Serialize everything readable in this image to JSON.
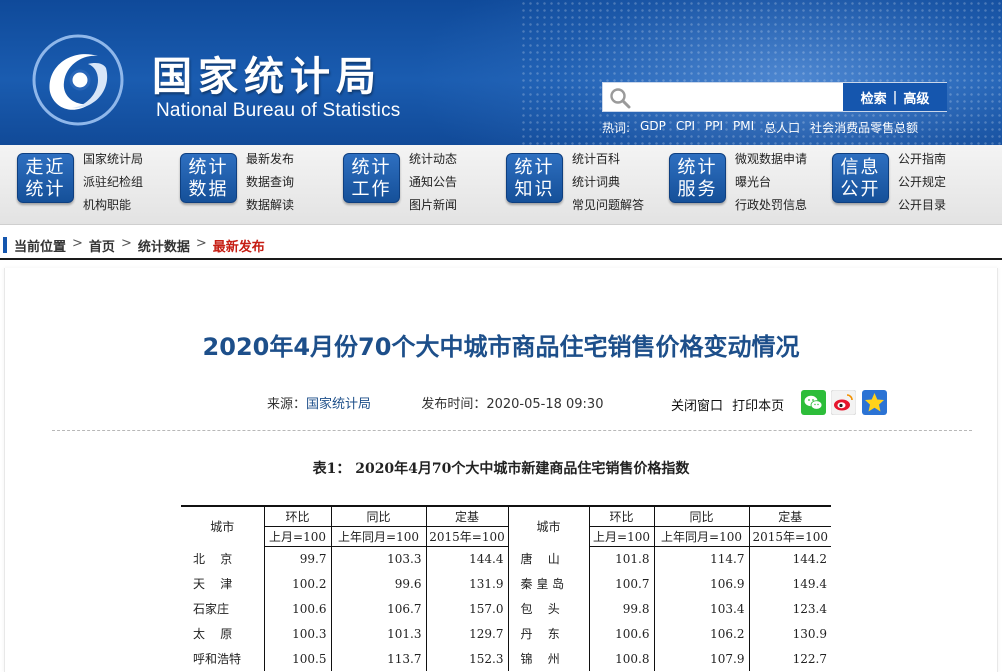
{
  "header": {
    "logo_cn": "国家统计局",
    "logo_en": "National Bureau of Statistics",
    "search": {
      "placeholder": "",
      "btn_search": "检索",
      "btn_sep": "|",
      "btn_advanced": "高级"
    },
    "hot_label": "热词:",
    "hot_words": [
      "GDP",
      "CPI",
      "PPI",
      "PMI",
      "总人口",
      "社会消费品零售总额"
    ]
  },
  "nav": {
    "groups": [
      {
        "tile": [
          "走近",
          "统计"
        ],
        "links": [
          "国家统计局",
          "派驻纪检组",
          "机构职能"
        ]
      },
      {
        "tile": [
          "统计",
          "数据"
        ],
        "links": [
          "最新发布",
          "数据查询",
          "数据解读"
        ]
      },
      {
        "tile": [
          "统计",
          "工作"
        ],
        "links": [
          "统计动态",
          "通知公告",
          "图片新闻"
        ]
      },
      {
        "tile": [
          "统计",
          "知识"
        ],
        "links": [
          "统计百科",
          "统计词典",
          "常见问题解答"
        ]
      },
      {
        "tile": [
          "统计",
          "服务"
        ],
        "links": [
          "微观数据申请",
          "曝光台",
          "行政处罚信息"
        ]
      },
      {
        "tile": [
          "信息",
          "公开"
        ],
        "links": [
          "公开指南",
          "公开规定",
          "公开目录"
        ]
      }
    ]
  },
  "breadcrumb": {
    "items": [
      "当前位置",
      "首页",
      "统计数据"
    ],
    "current": "最新发布",
    "arrow": ">"
  },
  "article": {
    "title": "2020年4月份70个大中城市商品住宅销售价格变动情况",
    "source_label": "来源：",
    "source": "国家统计局",
    "time_label": "发布时间：",
    "time": "2020-05-18 09:30",
    "close_window": "关闭窗口",
    "print_page": "打印本页"
  },
  "table": {
    "caption": "表1：  2020年4月70个大中城市新建商品住宅销售价格指数",
    "headers": {
      "city": "城市",
      "mom": "环比",
      "yoy": "同比",
      "base": "定基",
      "mom_sub": "上月=100",
      "yoy_sub": "上年同月=100",
      "base_sub": "2015年=100"
    },
    "rows": [
      {
        "c1": "北    京",
        "a1": "99.7",
        "b1": "103.3",
        "d1": "144.4",
        "c2": "唐    山",
        "a2": "101.8",
        "b2": "114.7",
        "d2": "144.2"
      },
      {
        "c1": "天    津",
        "a1": "100.2",
        "b1": "99.6",
        "d1": "131.9",
        "c2": "秦 皇 岛",
        "a2": "100.7",
        "b2": "106.9",
        "d2": "149.4"
      },
      {
        "c1": "石家庄",
        "a1": "100.6",
        "b1": "106.7",
        "d1": "157.0",
        "c2": "包    头",
        "a2": "99.8",
        "b2": "103.4",
        "d2": "123.4"
      },
      {
        "c1": "太    原",
        "a1": "100.3",
        "b1": "101.3",
        "d1": "129.7",
        "c2": "丹    东",
        "a2": "100.6",
        "b2": "106.2",
        "d2": "130.9"
      },
      {
        "c1": "呼和浩特",
        "a1": "100.5",
        "b1": "113.7",
        "d1": "152.3",
        "c2": "锦    州",
        "a2": "100.8",
        "b2": "107.9",
        "d2": "122.7"
      }
    ]
  },
  "colors": {
    "brand_blue": "#1556ae",
    "title_blue": "#1d4f8a",
    "current_red": "#c61e14"
  },
  "icons": [
    "nbs-logo-icon",
    "search-icon",
    "wechat-icon",
    "weibo-icon",
    "qzone-icon"
  ]
}
